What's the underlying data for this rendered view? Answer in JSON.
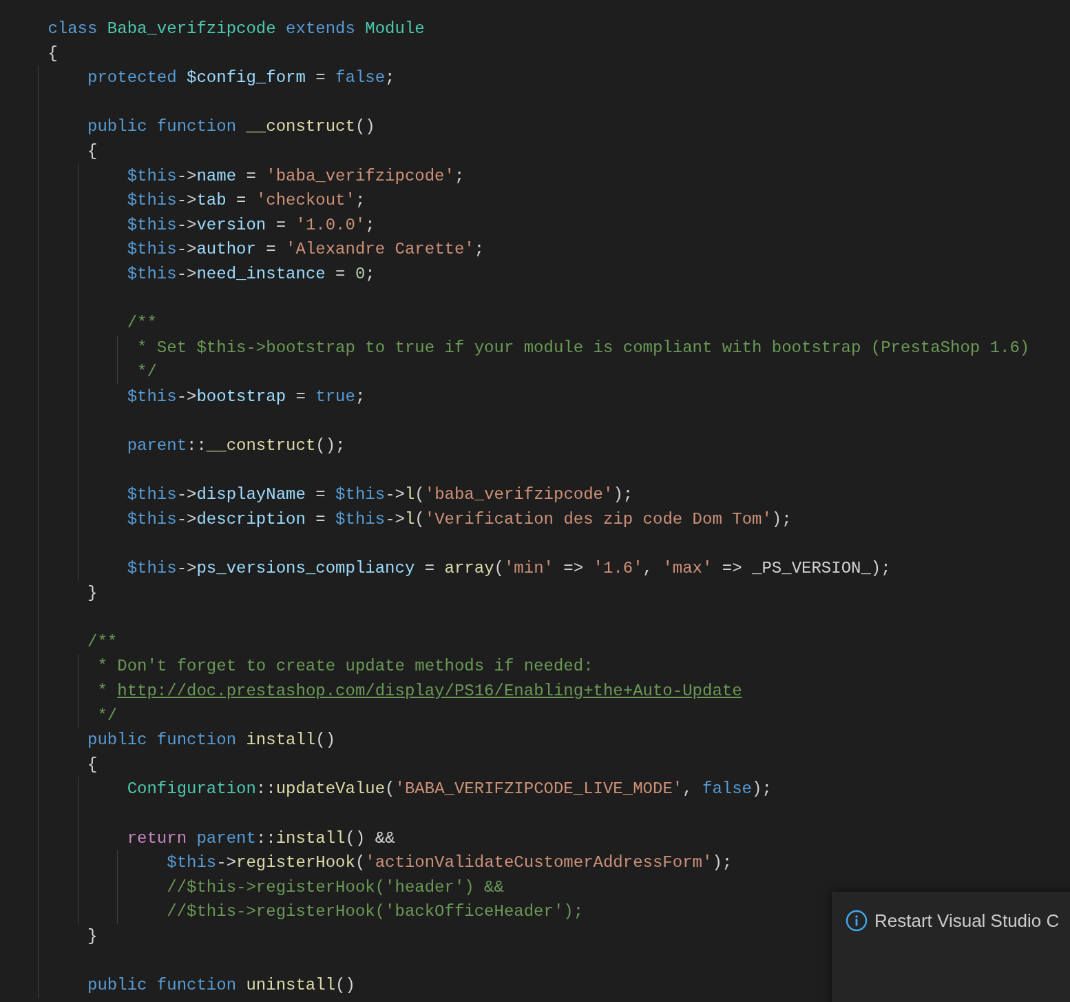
{
  "editor": {
    "blocks": [
      {
        "lines": [
          {
            "tokens": [
              {
                "kind": "keyword",
                "text": "class "
              },
              {
                "kind": "type",
                "text": "Baba_verifzipcode "
              },
              {
                "kind": "keyword",
                "text": "extends "
              },
              {
                "kind": "type",
                "text": "Module"
              }
            ]
          },
          {
            "tokens": [
              {
                "kind": "plain",
                "text": "{"
              }
            ]
          },
          {
            "tokens": [
              {
                "kind": "keyword",
                "text": "    protected "
              },
              {
                "kind": "variable",
                "text": "$config_form"
              },
              {
                "kind": "plain",
                "text": " = "
              },
              {
                "kind": "keyword",
                "text": "false"
              },
              {
                "kind": "plain",
                "text": ";"
              }
            ]
          }
        ]
      },
      {
        "lines": [
          {
            "tokens": [
              {
                "kind": "keyword",
                "text": "    public function "
              },
              {
                "kind": "function",
                "text": "__construct"
              },
              {
                "kind": "plain",
                "text": "()"
              }
            ]
          },
          {
            "tokens": [
              {
                "kind": "plain",
                "text": "    {"
              }
            ]
          },
          {
            "tokens": [
              {
                "kind": "keyword",
                "text": "        $this"
              },
              {
                "kind": "plain",
                "text": "->"
              },
              {
                "kind": "variable",
                "text": "name"
              },
              {
                "kind": "plain",
                "text": " = "
              },
              {
                "kind": "string",
                "text": "'baba_verifzipcode'"
              },
              {
                "kind": "plain",
                "text": ";"
              }
            ]
          },
          {
            "tokens": [
              {
                "kind": "keyword",
                "text": "        $this"
              },
              {
                "kind": "plain",
                "text": "->"
              },
              {
                "kind": "variable",
                "text": "tab"
              },
              {
                "kind": "plain",
                "text": " = "
              },
              {
                "kind": "string",
                "text": "'checkout'"
              },
              {
                "kind": "plain",
                "text": ";"
              }
            ]
          },
          {
            "tokens": [
              {
                "kind": "keyword",
                "text": "        $this"
              },
              {
                "kind": "plain",
                "text": "->"
              },
              {
                "kind": "variable",
                "text": "version"
              },
              {
                "kind": "plain",
                "text": " = "
              },
              {
                "kind": "string",
                "text": "'1.0.0'"
              },
              {
                "kind": "plain",
                "text": ";"
              }
            ]
          },
          {
            "tokens": [
              {
                "kind": "keyword",
                "text": "        $this"
              },
              {
                "kind": "plain",
                "text": "->"
              },
              {
                "kind": "variable",
                "text": "author"
              },
              {
                "kind": "plain",
                "text": " = "
              },
              {
                "kind": "string",
                "text": "'Alexandre Carette'"
              },
              {
                "kind": "plain",
                "text": ";"
              }
            ]
          },
          {
            "tokens": [
              {
                "kind": "keyword",
                "text": "        $this"
              },
              {
                "kind": "plain",
                "text": "->"
              },
              {
                "kind": "variable",
                "text": "need_instance"
              },
              {
                "kind": "plain",
                "text": " = "
              },
              {
                "kind": "number",
                "text": "0"
              },
              {
                "kind": "plain",
                "text": ";"
              }
            ]
          }
        ]
      },
      {
        "lines": [
          {
            "tokens": [
              {
                "kind": "comment",
                "text": "        /**"
              }
            ]
          },
          {
            "tokens": [
              {
                "kind": "comment",
                "text": "         * Set $this->bootstrap to true if your module is compliant with bootstrap (PrestaShop 1.6)"
              }
            ]
          },
          {
            "tokens": [
              {
                "kind": "comment",
                "text": "         */"
              }
            ]
          },
          {
            "tokens": [
              {
                "kind": "keyword",
                "text": "        $this"
              },
              {
                "kind": "plain",
                "text": "->"
              },
              {
                "kind": "variable",
                "text": "bootstrap"
              },
              {
                "kind": "plain",
                "text": " = "
              },
              {
                "kind": "keyword",
                "text": "true"
              },
              {
                "kind": "plain",
                "text": ";"
              }
            ]
          }
        ]
      },
      {
        "lines": [
          {
            "tokens": [
              {
                "kind": "keyword",
                "text": "        parent"
              },
              {
                "kind": "plain",
                "text": "::"
              },
              {
                "kind": "function",
                "text": "__construct"
              },
              {
                "kind": "plain",
                "text": "();"
              }
            ]
          }
        ]
      },
      {
        "lines": [
          {
            "tokens": [
              {
                "kind": "keyword",
                "text": "        $this"
              },
              {
                "kind": "plain",
                "text": "->"
              },
              {
                "kind": "variable",
                "text": "displayName"
              },
              {
                "kind": "plain",
                "text": " = "
              },
              {
                "kind": "keyword",
                "text": "$this"
              },
              {
                "kind": "plain",
                "text": "->"
              },
              {
                "kind": "function",
                "text": "l"
              },
              {
                "kind": "plain",
                "text": "("
              },
              {
                "kind": "string",
                "text": "'baba_verifzipcode'"
              },
              {
                "kind": "plain",
                "text": ");"
              }
            ]
          },
          {
            "tokens": [
              {
                "kind": "keyword",
                "text": "        $this"
              },
              {
                "kind": "plain",
                "text": "->"
              },
              {
                "kind": "variable",
                "text": "description"
              },
              {
                "kind": "plain",
                "text": " = "
              },
              {
                "kind": "keyword",
                "text": "$this"
              },
              {
                "kind": "plain",
                "text": "->"
              },
              {
                "kind": "function",
                "text": "l"
              },
              {
                "kind": "plain",
                "text": "("
              },
              {
                "kind": "string",
                "text": "'Verification des zip code Dom Tom'"
              },
              {
                "kind": "plain",
                "text": ");"
              }
            ]
          }
        ]
      },
      {
        "lines": [
          {
            "tokens": [
              {
                "kind": "keyword",
                "text": "        $this"
              },
              {
                "kind": "plain",
                "text": "->"
              },
              {
                "kind": "variable",
                "text": "ps_versions_compliancy"
              },
              {
                "kind": "plain",
                "text": " = "
              },
              {
                "kind": "function",
                "text": "array"
              },
              {
                "kind": "plain",
                "text": "("
              },
              {
                "kind": "string",
                "text": "'min'"
              },
              {
                "kind": "plain",
                "text": " => "
              },
              {
                "kind": "string",
                "text": "'1.6'"
              },
              {
                "kind": "plain",
                "text": ", "
              },
              {
                "kind": "string",
                "text": "'max'"
              },
              {
                "kind": "plain",
                "text": " => _PS_VERSION_);"
              }
            ]
          },
          {
            "tokens": [
              {
                "kind": "plain",
                "text": "    }"
              }
            ]
          }
        ]
      },
      {
        "lines": [
          {
            "tokens": [
              {
                "kind": "comment",
                "text": "    /**"
              }
            ]
          },
          {
            "tokens": [
              {
                "kind": "comment",
                "text": "     * Don't forget to create update methods if needed:"
              }
            ]
          },
          {
            "tokens": [
              {
                "kind": "comment",
                "text": "     * "
              },
              {
                "kind": "link",
                "text": "http://doc.prestashop.com/display/PS16/Enabling+the+Auto-Update"
              }
            ]
          },
          {
            "tokens": [
              {
                "kind": "comment",
                "text": "     */"
              }
            ]
          },
          {
            "tokens": [
              {
                "kind": "keyword",
                "text": "    public function "
              },
              {
                "kind": "function",
                "text": "install"
              },
              {
                "kind": "plain",
                "text": "()"
              }
            ]
          },
          {
            "tokens": [
              {
                "kind": "plain",
                "text": "    {"
              }
            ]
          },
          {
            "tokens": [
              {
                "kind": "type",
                "text": "        Configuration"
              },
              {
                "kind": "plain",
                "text": "::"
              },
              {
                "kind": "function",
                "text": "updateValue"
              },
              {
                "kind": "plain",
                "text": "("
              },
              {
                "kind": "string",
                "text": "'BABA_VERIFZIPCODE_LIVE_MODE'"
              },
              {
                "kind": "plain",
                "text": ", "
              },
              {
                "kind": "keyword",
                "text": "false"
              },
              {
                "kind": "plain",
                "text": ");"
              }
            ]
          }
        ]
      },
      {
        "lines": [
          {
            "tokens": [
              {
                "kind": "control",
                "text": "        return "
              },
              {
                "kind": "keyword",
                "text": "parent"
              },
              {
                "kind": "plain",
                "text": "::"
              },
              {
                "kind": "function",
                "text": "install"
              },
              {
                "kind": "plain",
                "text": "() &&"
              }
            ]
          },
          {
            "tokens": [
              {
                "kind": "keyword",
                "text": "            $this"
              },
              {
                "kind": "plain",
                "text": "->"
              },
              {
                "kind": "function",
                "text": "registerHook"
              },
              {
                "kind": "plain",
                "text": "("
              },
              {
                "kind": "string",
                "text": "'actionValidateCustomerAddressForm'"
              },
              {
                "kind": "plain",
                "text": ");"
              }
            ]
          },
          {
            "tokens": [
              {
                "kind": "comment",
                "text": "            //$this->registerHook('header') &&"
              }
            ]
          },
          {
            "tokens": [
              {
                "kind": "comment",
                "text": "            //$this->registerHook('backOfficeHeader');"
              }
            ]
          },
          {
            "tokens": [
              {
                "kind": "plain",
                "text": "    }"
              }
            ]
          }
        ]
      },
      {
        "lines": [
          {
            "tokens": [
              {
                "kind": "keyword",
                "text": "    public function "
              },
              {
                "kind": "function",
                "text": "uninstall"
              },
              {
                "kind": "plain",
                "text": "()"
              }
            ]
          }
        ]
      }
    ]
  },
  "notification": {
    "message": "Restart Visual Studio C"
  }
}
